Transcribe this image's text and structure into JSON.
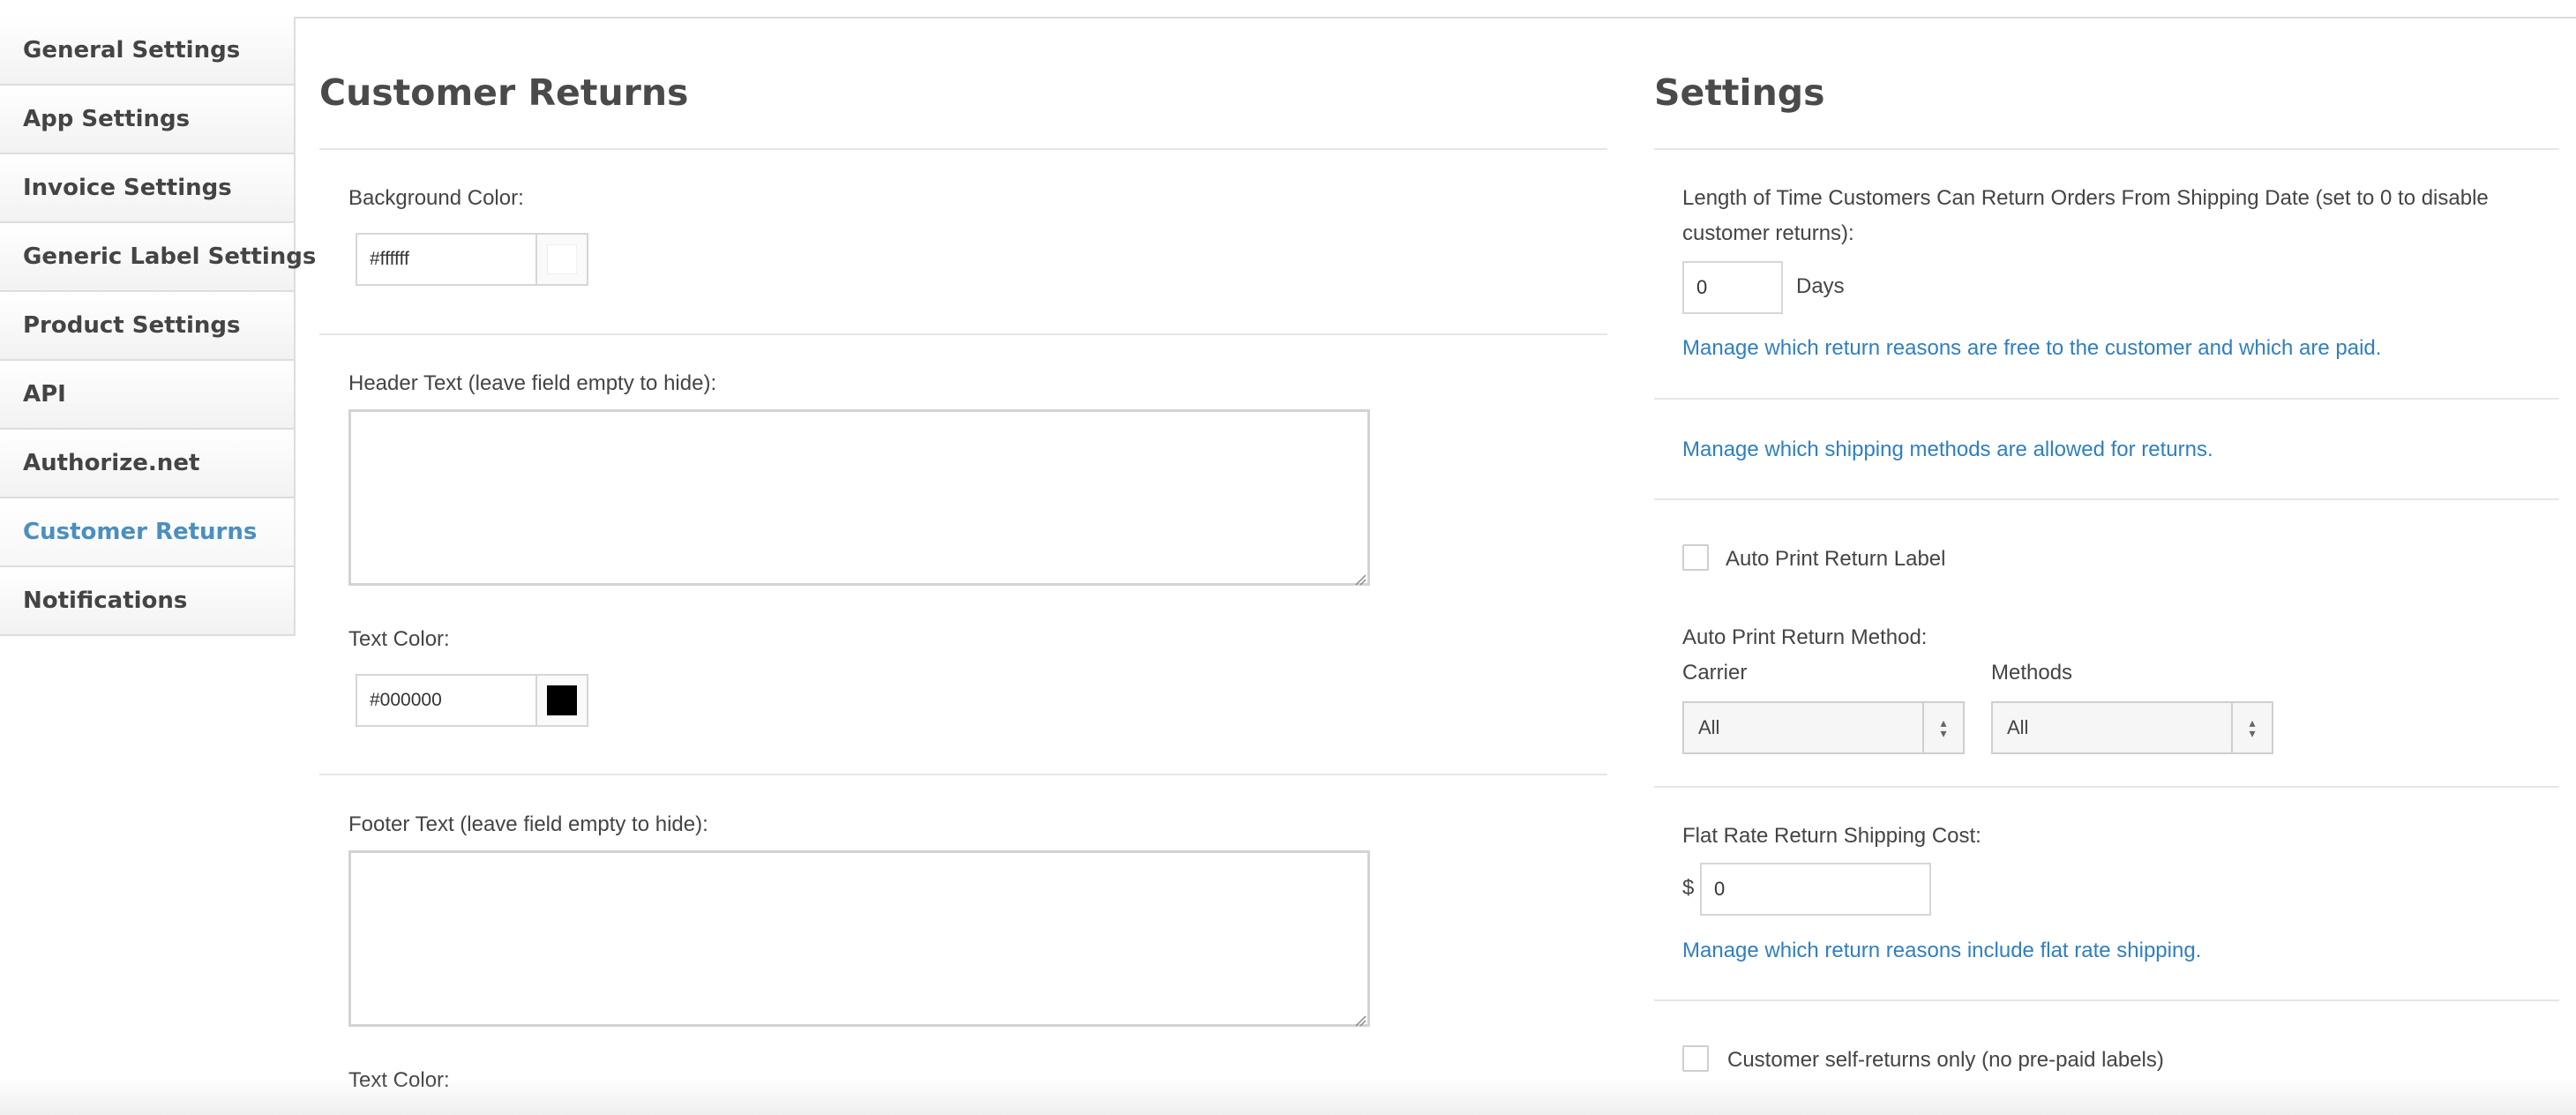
{
  "sidebar": {
    "items": [
      {
        "label": "General Settings"
      },
      {
        "label": "App Settings"
      },
      {
        "label": "Invoice Settings"
      },
      {
        "label": "Generic Label Settings"
      },
      {
        "label": "Product Settings"
      },
      {
        "label": "API"
      },
      {
        "label": "Authorize.net"
      },
      {
        "label": "Customer Returns",
        "active": true
      },
      {
        "label": "Notifications"
      }
    ]
  },
  "left": {
    "title": "Customer Returns",
    "background_color_label": "Background Color:",
    "background_color_value": "#ffffff",
    "header_text_label": "Header Text (leave field empty to hide):",
    "header_text_value": "",
    "header_text_color_label": "Text Color:",
    "header_text_color_value": "#000000",
    "footer_text_label": "Footer Text (leave field empty to hide):",
    "footer_text_value": "",
    "footer_text_color_label": "Text Color:"
  },
  "right": {
    "title": "Settings",
    "return_time_label_line1": "Length of Time Customers Can Return Orders From Shipping Date (set to 0 to disable",
    "return_time_label_line2": "customer returns):",
    "return_days_value": "0",
    "days_unit": "Days",
    "link_free_paid": "Manage which return reasons are free to the customer and which are paid.",
    "link_shipping_methods": "Manage which shipping methods are allowed for returns.",
    "auto_print_label": "Auto Print Return Label",
    "auto_print_checked": false,
    "auto_print_method_label": "Auto Print Return Method:",
    "carrier_label": "Carrier",
    "carrier_value": "All",
    "methods_label": "Methods",
    "methods_value": "All",
    "flat_rate_label": "Flat Rate Return Shipping Cost:",
    "currency_symbol": "$",
    "flat_rate_value": "0",
    "link_flat_rate": "Manage which return reasons include flat rate shipping.",
    "self_returns_label": "Customer self-returns only (no pre-paid labels)",
    "self_returns_checked": false
  },
  "colors": {
    "link": "#2f7fc0",
    "active_nav": "#4a8fc0",
    "swatch_white": "#ffffff",
    "swatch_black": "#000000"
  }
}
